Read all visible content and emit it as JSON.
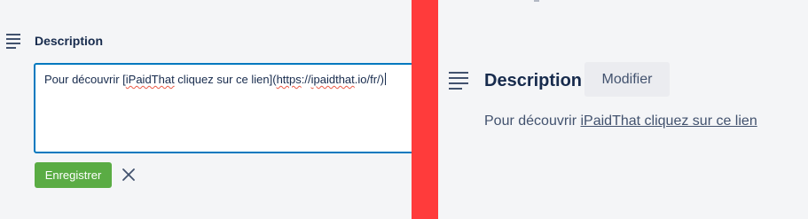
{
  "edit_panel": {
    "heading": "Description",
    "textarea": {
      "before": "Pour découvrir [",
      "word_ipaidthat": "iPaidThat",
      "middle": " cliquez sur ce lien](",
      "url_https": "https",
      "url_sep": "://",
      "url_host": "ipaidthat",
      "url_rest": ".io/fr/)"
    },
    "save_label": "Enregistrer",
    "close_icon": "close-icon"
  },
  "view_panel": {
    "heading": "Description",
    "modify_label": "Modifier",
    "text_prefix": "Pour découvrir ",
    "link_text": "iPaidThat cliquez sur ce lien"
  },
  "colors": {
    "save_button": "#5aac44",
    "textarea_border": "#0079bf",
    "divider": "#ff3b3b",
    "background": "#f4f5f7",
    "modify_button": "#ebecf0"
  }
}
